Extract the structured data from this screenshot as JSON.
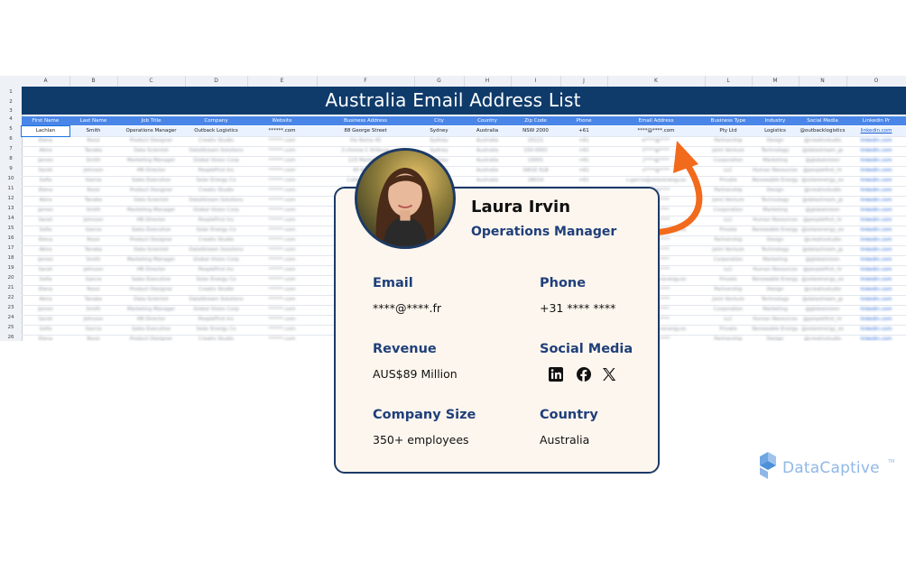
{
  "sheet": {
    "title": "Australia Email Address List",
    "col_letters": [
      "A",
      "B",
      "C",
      "D",
      "E",
      "F",
      "G",
      "H",
      "I",
      "J",
      "K",
      "L",
      "M",
      "N",
      "O"
    ],
    "row_numbers": [
      "1",
      "2",
      "3",
      "4",
      "5",
      "6",
      "7",
      "8",
      "9",
      "10",
      "11",
      "12",
      "13",
      "14",
      "15",
      "16",
      "17",
      "18",
      "19",
      "20",
      "21",
      "22",
      "23",
      "24",
      "25",
      "26"
    ],
    "headers": [
      "First Name",
      "Last Name",
      "Job Title",
      "Company",
      "Website",
      "Business Address",
      "City",
      "Country",
      "Zip Code",
      "Phone",
      "Email Address",
      "Business Type",
      "Industry",
      "Social Media",
      "Linkedin Pr"
    ],
    "selected_row": [
      "Lachlan",
      "Smith",
      "Operations Manager",
      "Outback Logistics",
      "******.com",
      "88 George Street",
      "Sydney",
      "Australia",
      "NSW 2000",
      "+61",
      "****@****.com",
      "Pty Ltd",
      "Logistics",
      "@outbacklogistics",
      "linkedin.com"
    ],
    "blurred_rows": [
      [
        "Elena",
        "Rossi",
        "Product Designer",
        "Creativ Studio",
        "******.com",
        "Via Roma 45",
        "Sydney",
        "Australia",
        "20121",
        "+61",
        "e****@****",
        "Partnership",
        "Design",
        "@creativstudio",
        "linkedin.com"
      ],
      [
        "Akira",
        "Tanaka",
        "Data Scientist",
        "DataStream Solutions",
        "******.com",
        "2-chome-1 Shibuya",
        "Sydney",
        "Australia",
        "150-0002",
        "+61",
        "t****@****",
        "Joint Venture",
        "Technology",
        "@datastream_jp",
        "linkedin.com"
      ],
      [
        "James",
        "Smith",
        "Marketing Manager",
        "Global Vision Corp",
        "******.com",
        "123 Market St",
        "Sydney",
        "Australia",
        "10001",
        "+61",
        "j****@****",
        "Corporation",
        "Marketing",
        "@globalvision",
        "linkedin.com"
      ],
      [
        "Sarah",
        "Johnson",
        "HR Director",
        "PeopleFirst Inc",
        "******.com",
        "45 King St",
        "Sydney",
        "Australia",
        "SW1E 5LB",
        "+61",
        "s****@****",
        "LLC",
        "Human Resources",
        "@peoplefirst_hr",
        "linkedin.com"
      ],
      [
        "Sofia",
        "Garcia",
        "Sales Executive",
        "Solar Energy Co",
        "******.com",
        "Calle Mayor 12",
        "Sydney",
        "Australia",
        "28014",
        "+61",
        "s.garcia@solarenergy.es",
        "Private",
        "Renewable Energy",
        "@solarenergy_es",
        "linkedin.com"
      ]
    ]
  },
  "card": {
    "name": "Laura Irvin",
    "role": "Operations Manager",
    "email_label": "Email",
    "email_value": "****@****.fr",
    "phone_label": "Phone",
    "phone_value": "+31 **** ****",
    "revenue_label": "Revenue",
    "revenue_value": "AUS$89 Million",
    "social_label": "Social Media",
    "social_icons": [
      "linkedin-icon",
      "facebook-icon",
      "x-icon"
    ],
    "company_size_label": "Company Size",
    "company_size_value": "350+ employees",
    "country_label": "Country",
    "country_value": "Australia"
  },
  "logo": {
    "text": "DataCaptive",
    "tm": "TM"
  },
  "colors": {
    "navy": "#0f3b6b",
    "header_blue": "#4a86e8",
    "arrow_orange": "#f26a1b",
    "card_bg": "#fdf6ee",
    "label_blue": "#1f3f7a"
  }
}
